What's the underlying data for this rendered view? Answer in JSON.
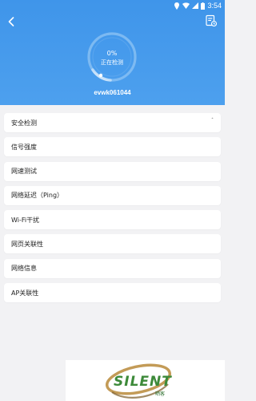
{
  "status_bar": {
    "time": "3:54"
  },
  "header": {
    "progress": {
      "percent_label": "0%",
      "status_label": "正在检测",
      "fraction": 0.0
    },
    "device_name": "evwk061044"
  },
  "menu": {
    "items": [
      {
        "label": "安全检测",
        "expanded_indicator": "ˆ"
      },
      {
        "label": "信号强度"
      },
      {
        "label": "网速测试"
      },
      {
        "label": "网络延迟（Ping）"
      },
      {
        "label": "Wi-Fi干扰"
      },
      {
        "label": "网页关联性"
      },
      {
        "label": "网络信息"
      },
      {
        "label": "AP关联性"
      }
    ]
  },
  "watermark": {
    "brand": "SILENT",
    "sub": "晒客"
  },
  "colors": {
    "header_blue": "#4499ec",
    "background": "#f2f2f4"
  }
}
